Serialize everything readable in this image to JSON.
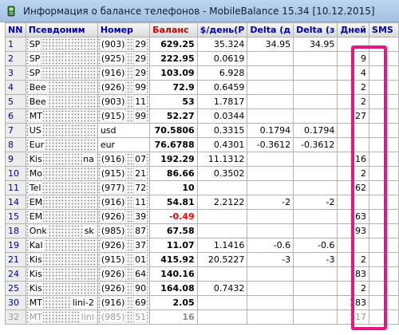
{
  "window": {
    "title": "Информация о балансе телефонов - MobileBalance 15.34 [10.12.2015]"
  },
  "columns": [
    "NN",
    "Псевдоним",
    "Номер",
    "Баланс",
    "$/день(Р",
    "Delta (д",
    "Delta (з",
    "Дней",
    "SMS"
  ],
  "rows": [
    {
      "nn": "1",
      "alias": "SP",
      "number": "(903)",
      "tail": "29",
      "balance": "629.25",
      "perday": "35.324",
      "dday": "34.95",
      "dz": "34.95",
      "days": "",
      "sms": ""
    },
    {
      "nn": "2",
      "alias": "SP",
      "number": "(925)",
      "tail": "29",
      "balance": "222.95",
      "perday": "0.0619",
      "dday": "",
      "dz": "",
      "days": "9",
      "sms": ""
    },
    {
      "nn": "3",
      "alias": "SP",
      "number": "(916)",
      "tail": "29",
      "balance": "103.09",
      "perday": "6.928",
      "dday": "",
      "dz": "",
      "days": "4",
      "sms": ""
    },
    {
      "nn": "4",
      "alias": "Bee",
      "number": "(926)",
      "tail": "99",
      "balance": "72.9",
      "perday": "0.6459",
      "dday": "",
      "dz": "",
      "days": "2",
      "sms": ""
    },
    {
      "nn": "5",
      "alias": "Bee",
      "number": "(903)",
      "tail": "11",
      "balance": "53",
      "perday": "1.7817",
      "dday": "",
      "dz": "",
      "days": "2",
      "sms": ""
    },
    {
      "nn": "6",
      "alias": "MT",
      "number": "(915)",
      "tail": "99",
      "balance": "52.27",
      "perday": "0.0344",
      "dday": "",
      "dz": "",
      "days": "27",
      "sms": ""
    },
    {
      "nn": "7",
      "alias": "US",
      "number": "usd",
      "tail": "",
      "balance": "70.5806",
      "perday": "0.3315",
      "dday": "0.1794",
      "dz": "0.1794",
      "days": "",
      "sms": ""
    },
    {
      "nn": "8",
      "alias": "Eur",
      "number": "eur",
      "tail": "",
      "balance": "76.6788",
      "perday": "0.4301",
      "dday": "-0.3612",
      "dz": "-0.3612",
      "days": "",
      "sms": ""
    },
    {
      "nn": "9",
      "alias": "Kis",
      "aliasTail": "na",
      "number": "(916)",
      "tail": "07",
      "balance": "192.29",
      "perday": "11.1312",
      "dday": "",
      "dz": "",
      "days": "16",
      "sms": ""
    },
    {
      "nn": "10",
      "alias": "Mo",
      "number": "(915)",
      "tail": "21",
      "balance": "86.66",
      "perday": "0.3502",
      "dday": "",
      "dz": "",
      "days": "2",
      "sms": ""
    },
    {
      "nn": "11",
      "alias": "Tel",
      "number": "(977)",
      "tail": "72",
      "balance": "10",
      "perday": "",
      "dday": "",
      "dz": "",
      "days": "62",
      "sms": ""
    },
    {
      "nn": "14",
      "alias": "EM",
      "number": "(916)",
      "tail": "11",
      "balance": "54.81",
      "perday": "2.2122",
      "dday": "-2",
      "dz": "-2",
      "days": "",
      "sms": ""
    },
    {
      "nn": "15",
      "alias": "EM",
      "number": "(926)",
      "tail": "39",
      "balance": "-0.49",
      "perday": "",
      "dday": "",
      "dz": "",
      "days": "63",
      "sms": "",
      "neg": true
    },
    {
      "nn": "18",
      "alias": "Onk",
      "aliasTail": "sk",
      "number": "(985)",
      "tail": "87",
      "balance": "67.58",
      "perday": "",
      "dday": "",
      "dz": "",
      "days": "93",
      "sms": ""
    },
    {
      "nn": "19",
      "alias": "Kal",
      "number": "(926)",
      "tail": "37",
      "balance": "11.07",
      "perday": "1.1416",
      "dday": "-0.6",
      "dz": "-0.6",
      "days": "",
      "sms": ""
    },
    {
      "nn": "21",
      "alias": "Kis",
      "number": "(915)",
      "tail": "01",
      "balance": "415.92",
      "perday": "20.5227",
      "dday": "-3",
      "dz": "-3",
      "days": "2",
      "sms": ""
    },
    {
      "nn": "24",
      "alias": "Kis",
      "number": "(926)",
      "tail": "64",
      "balance": "140.16",
      "perday": "",
      "dday": "",
      "dz": "",
      "days": "83",
      "sms": ""
    },
    {
      "nn": "25",
      "alias": "Kis",
      "number": "(926)",
      "tail": "90",
      "balance": "164.08",
      "perday": "0.7432",
      "dday": "",
      "dz": "",
      "days": "2",
      "sms": ""
    },
    {
      "nn": "30",
      "alias": "MT",
      "aliasTail": "lini-2",
      "number": "(916)",
      "tail": "69",
      "balance": "2.05",
      "perday": "",
      "dday": "",
      "dz": "",
      "days": "183",
      "sms": ""
    },
    {
      "nn": "32",
      "alias": "MT",
      "aliasTail": "lini",
      "number": "(985)",
      "tail": "51",
      "balance": "16",
      "perday": "",
      "dday": "",
      "dz": "",
      "days": "117",
      "sms": "",
      "dim": true
    }
  ],
  "colors": {
    "highlight": "#e8177d",
    "negative": "#ff0000",
    "header_text": "#0000b4",
    "balance_header": "#cc0000"
  },
  "icons": {
    "app": "phone-app-icon"
  }
}
